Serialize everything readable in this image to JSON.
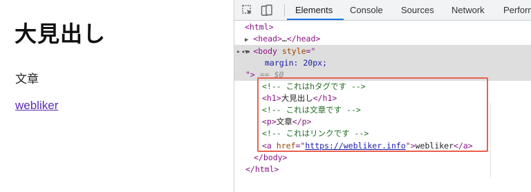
{
  "page": {
    "heading": "大見出し",
    "paragraph": "文章",
    "link_text": "webliker"
  },
  "devtools": {
    "tabs": [
      "Elements",
      "Console",
      "Sources",
      "Network",
      "Perform"
    ],
    "active_tab": "Elements",
    "tree": {
      "html_open": "<html>",
      "head_open": "<head>",
      "head_ellipsis": "…",
      "head_close": "</head>",
      "body_open": "<body",
      "style_attr": "style",
      "style_eq_quote": "=\"",
      "style_value": "margin: 20px;",
      "close_quote": "\">",
      "eq_marker": "== $0",
      "comment_h": "<!-- これはhタグです -->",
      "h1_open": "<h1>",
      "h1_text": "大見出し",
      "h1_close": "</h1>",
      "comment_p": "<!-- これは文章です -->",
      "p_open": "<p>",
      "p_text": "文章",
      "p_close": "</p>",
      "comment_a": "<!-- これはリンクです -->",
      "a_open": "<a",
      "a_href_attr": "href",
      "a_href_eq": "=\"",
      "a_href_value": "https://webliker.info",
      "a_href_end": "\">",
      "a_text": "webliker",
      "a_close": "</a>",
      "body_close": "</body>",
      "html_close": "</html>",
      "dots": "•••"
    }
  },
  "colors": {
    "highlight_box": "#e8604c",
    "tab_underline": "#1a73e8",
    "tag": "#881280",
    "comment": "#236e25"
  }
}
